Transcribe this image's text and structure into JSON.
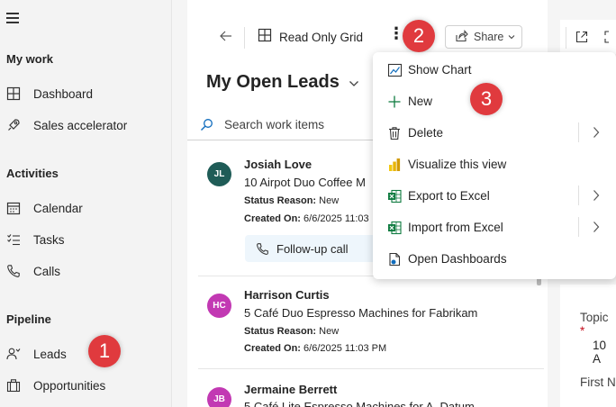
{
  "sidebar": {
    "groups": {
      "my_work": "My work",
      "activities": "Activities",
      "pipeline": "Pipeline"
    },
    "items": [
      {
        "label": "Dashboard",
        "icon": "dashboard-icon"
      },
      {
        "label": "Sales accelerator",
        "icon": "rocket-icon"
      },
      {
        "label": "Calendar",
        "icon": "calendar-icon"
      },
      {
        "label": "Tasks",
        "icon": "tasks-icon"
      },
      {
        "label": "Calls",
        "icon": "phone-icon"
      },
      {
        "label": "Leads",
        "icon": "person-icon"
      },
      {
        "label": "Opportunities",
        "icon": "briefcase-icon"
      }
    ]
  },
  "badges": [
    "1",
    "2",
    "3"
  ],
  "commandbar": {
    "grid_label": "Read Only Grid",
    "share_label": "Share"
  },
  "view": {
    "title": "My Open Leads",
    "search_placeholder": "Search work items"
  },
  "leads": [
    {
      "initials": "JL",
      "avatar_color": "#1f5c57",
      "name": "Josiah Love",
      "topic": "10 Airpot Duo Coffee M",
      "status_label": "Status Reason:",
      "status": "New",
      "created_label": "Created On:",
      "created": "6/6/2025 11:03",
      "action": "Follow-up call"
    },
    {
      "initials": "HC",
      "avatar_color": "#c239b3",
      "name": "Harrison Curtis",
      "topic": "5 Café Duo Espresso Machines for Fabrikam",
      "status_label": "Status Reason:",
      "status": "New",
      "created_label": "Created On:",
      "created": "6/6/2025 11:03 PM"
    },
    {
      "initials": "JB",
      "avatar_color": "#c239b3",
      "name": "Jermaine Berrett",
      "topic": "5 Café Lite Espresso Machines for A. Datum"
    }
  ],
  "menu": {
    "items": [
      {
        "label": "Show Chart",
        "icon": "chart-icon",
        "submenu": false
      },
      {
        "label": "New",
        "icon": "plus-icon",
        "submenu": false
      },
      {
        "label": "Delete",
        "icon": "trash-icon",
        "submenu": true
      },
      {
        "label": "Visualize this view",
        "icon": "powerbi-icon",
        "submenu": false
      },
      {
        "label": "Export to Excel",
        "icon": "excel-icon",
        "submenu": true
      },
      {
        "label": "Import from Excel",
        "icon": "excel-icon",
        "submenu": true
      },
      {
        "label": "Open Dashboards",
        "icon": "dashboard-doc-icon",
        "submenu": false
      }
    ]
  },
  "form": {
    "topic_label": "Topic",
    "topic_required": "*",
    "topic_value": "10 A",
    "first_name_label": "First N"
  },
  "colors": {
    "badge": "#e03a3e",
    "accent": "#0f6cbd",
    "excel": "#107c41",
    "powerbi": "#f2c811"
  }
}
